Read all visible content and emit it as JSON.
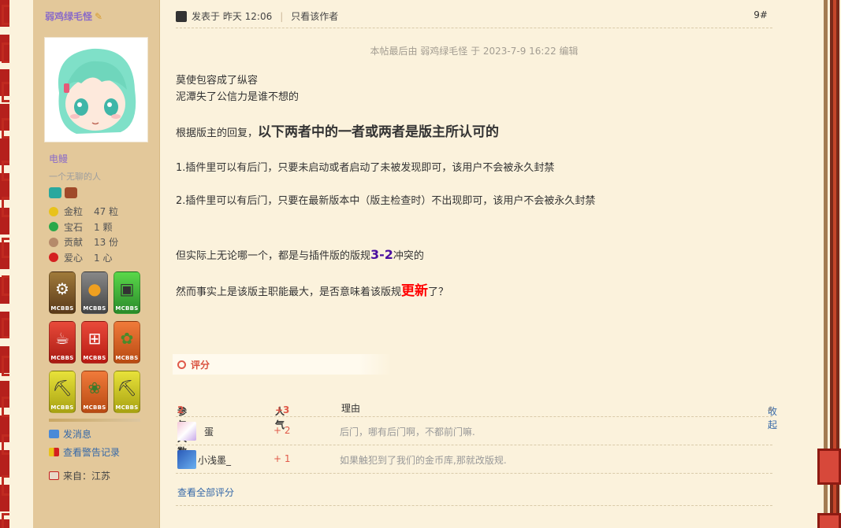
{
  "user": {
    "name": "弱鸡绿毛怪",
    "group": "电鳗",
    "custom_title": "一个无聊的人",
    "stats": [
      {
        "label": "金粒",
        "value": "47 粒",
        "icon": "gold-nugget-icon",
        "color": "#e8c21a"
      },
      {
        "label": "宝石",
        "value": "1 颗",
        "icon": "emerald-icon",
        "color": "#2aa84a"
      },
      {
        "label": "贡献",
        "value": "13 份",
        "icon": "contribution-icon",
        "color": "#b58a6a"
      },
      {
        "label": "爱心",
        "value": "1 心",
        "icon": "heart-apple-icon",
        "color": "#d42020"
      }
    ],
    "badges": [
      {
        "icon": "dispenser-badge-icon",
        "glyph": "⚙",
        "color": "#8a6a2a"
      },
      {
        "icon": "water-lava-badge-icon",
        "glyph": "💧",
        "color": "#6a6a6a"
      },
      {
        "icon": "piston-badge-icon",
        "glyph": "▣",
        "color": "#3ea83a"
      },
      {
        "icon": "java-badge-icon",
        "glyph": "☕",
        "color": "#c8261e"
      },
      {
        "icon": "windows-badge-icon",
        "glyph": "⊞",
        "color": "#d8261e"
      },
      {
        "icon": "sapling-badge-icon",
        "glyph": "✿",
        "color": "#d8561e"
      },
      {
        "icon": "pickaxe-badge-icon",
        "glyph": "⛏",
        "color": "#c8c21a"
      },
      {
        "icon": "tree-badge-icon",
        "glyph": "❀",
        "color": "#c8561e"
      },
      {
        "icon": "pickaxe-gold-badge-icon",
        "glyph": "⛏",
        "color": "#c8c21a"
      }
    ],
    "badge_label": "MCBBS",
    "links": {
      "message": "发消息",
      "warnings": "查看警告记录"
    },
    "location": "来自：江苏"
  },
  "post": {
    "posted_at": "发表于 昨天 12:06",
    "only_author": "只看该作者",
    "floor": "9#",
    "edit_note": "本帖最后由 弱鸡绿毛怪 于 2023-7-9 16:22 编辑",
    "lines": {
      "l1": "莫使包容成了纵容",
      "l2": "泥潭失了公信力是谁不想的",
      "l3a": "根据版主的回复，",
      "l3b": "以下两者中的一者或两者是版主所认可的",
      "l4": "1.插件里可以有后门，只要未启动或者启动了未被发现即可，该用户不会被永久封禁",
      "l5": "2.插件里可以有后门，只要在最新版本中（版主检查时）不出现即可，该用户不会被永久封禁",
      "l6a": "但实际上无论哪一个，都是与插件版的版规",
      "l6b": "3-2",
      "l6c": "冲突的",
      "l7a": "然而事实上是该版主职能最大，是否意味着该版规",
      "l7b": "更新",
      "l7c": "了？"
    }
  },
  "rating": {
    "tab_label": "评分",
    "head": {
      "participants": "参与人数",
      "participants_count": "2",
      "popularity": "人气",
      "popularity_value": "+3",
      "reason": "理由",
      "collapse": "收起"
    },
    "rows": [
      {
        "user": "蛋",
        "score": "+ 2",
        "reason": "后门，哪有后门啊，不都前门嘛."
      },
      {
        "user": "小浅墨_",
        "score": "+ 1",
        "reason": "如果触犯到了我们的金币库,那就改版规."
      }
    ],
    "view_all": "查看全部评分"
  }
}
